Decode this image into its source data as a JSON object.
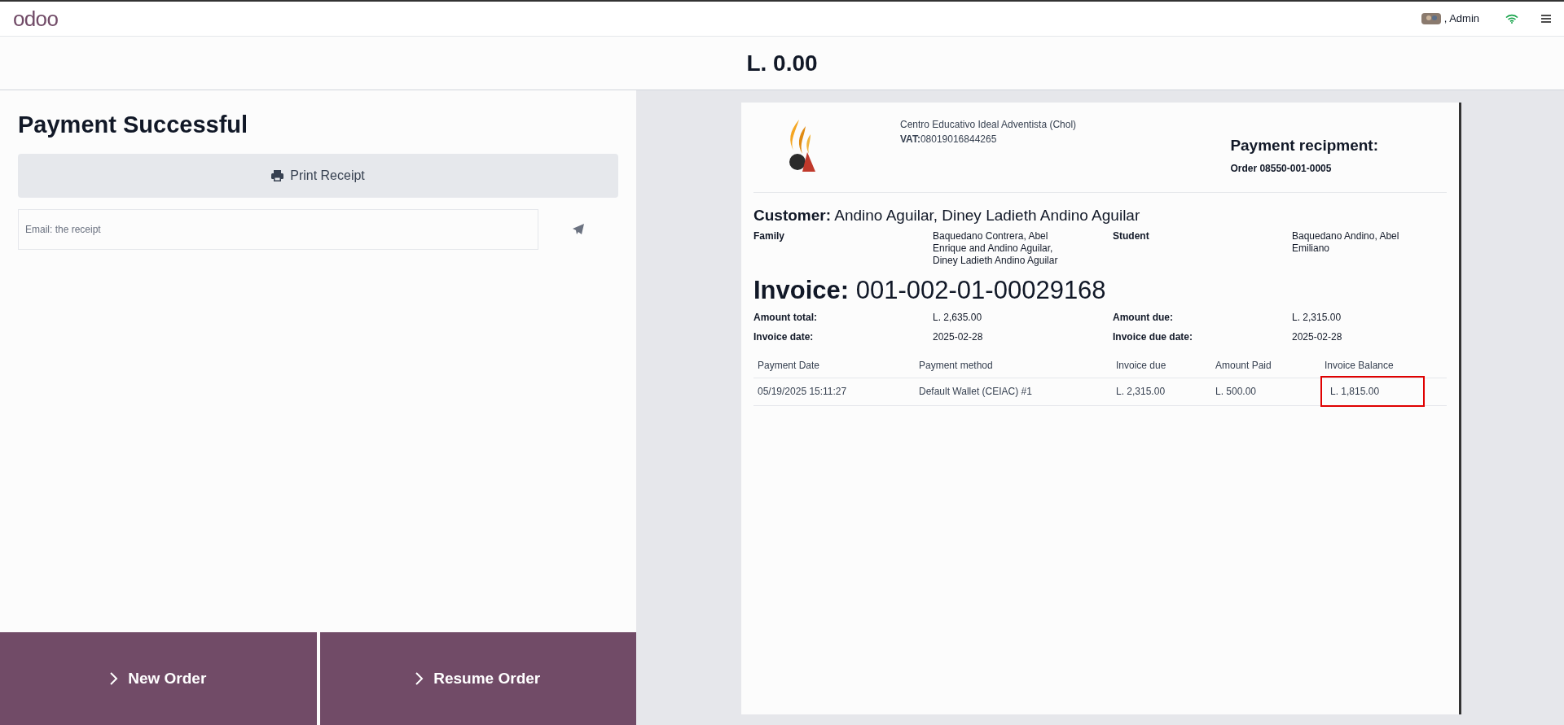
{
  "top_bar": {
    "logo": "odoo",
    "user": ", Admin"
  },
  "amount": "L. 0.00",
  "left": {
    "title": "Payment Successful",
    "print_button": "Print Receipt",
    "email": {
      "placeholder": "Email: the receipt"
    },
    "actions": [
      {
        "label": "New Order"
      },
      {
        "label": "Resume Order"
      }
    ]
  },
  "receipt": {
    "company": "Centro Educativo Ideal Adventista (Chol)",
    "vat_label": "VAT:",
    "vat": "08019016844265",
    "heading": "Payment recipment:",
    "order": "Order 08550-001-0005",
    "customer_label": "Customer:",
    "customer": "Andino Aguilar, Diney Ladieth Andino Aguilar",
    "people": [
      {
        "label": "Family",
        "value": "Baquedano Contrera, Abel Enrique and Andino Aguilar, Diney Ladieth Andino Aguilar"
      },
      {
        "label": "Student",
        "value": "Baquedano Andino, Abel Emiliano"
      }
    ],
    "invoice_label": "Invoice:",
    "invoice": "001-002-01-00029168",
    "amounts": [
      {
        "label": "Amount total:",
        "value": "L. 2,635.00"
      },
      {
        "label": "Amount due:",
        "value": "L. 2,315.00"
      },
      {
        "label": "Invoice date:",
        "value": "2025-02-28"
      },
      {
        "label": "Invoice due date:",
        "value": "2025-02-28"
      }
    ],
    "table": {
      "columns": [
        "Payment Date",
        "Payment method",
        "Invoice due",
        "Amount Paid",
        "Invoice Balance"
      ],
      "rows": [
        {
          "cells": [
            {
              "text": "05/19/2025 15:11:27",
              "highlighted": false
            },
            {
              "text": "Default Wallet (CEIAC) #1",
              "highlighted": false
            },
            {
              "text": "L. 2,315.00",
              "highlighted": false
            },
            {
              "text": "L. 500.00",
              "highlighted": false
            },
            {
              "text": "L. 1,815.00",
              "highlighted": true
            }
          ]
        }
      ]
    }
  }
}
